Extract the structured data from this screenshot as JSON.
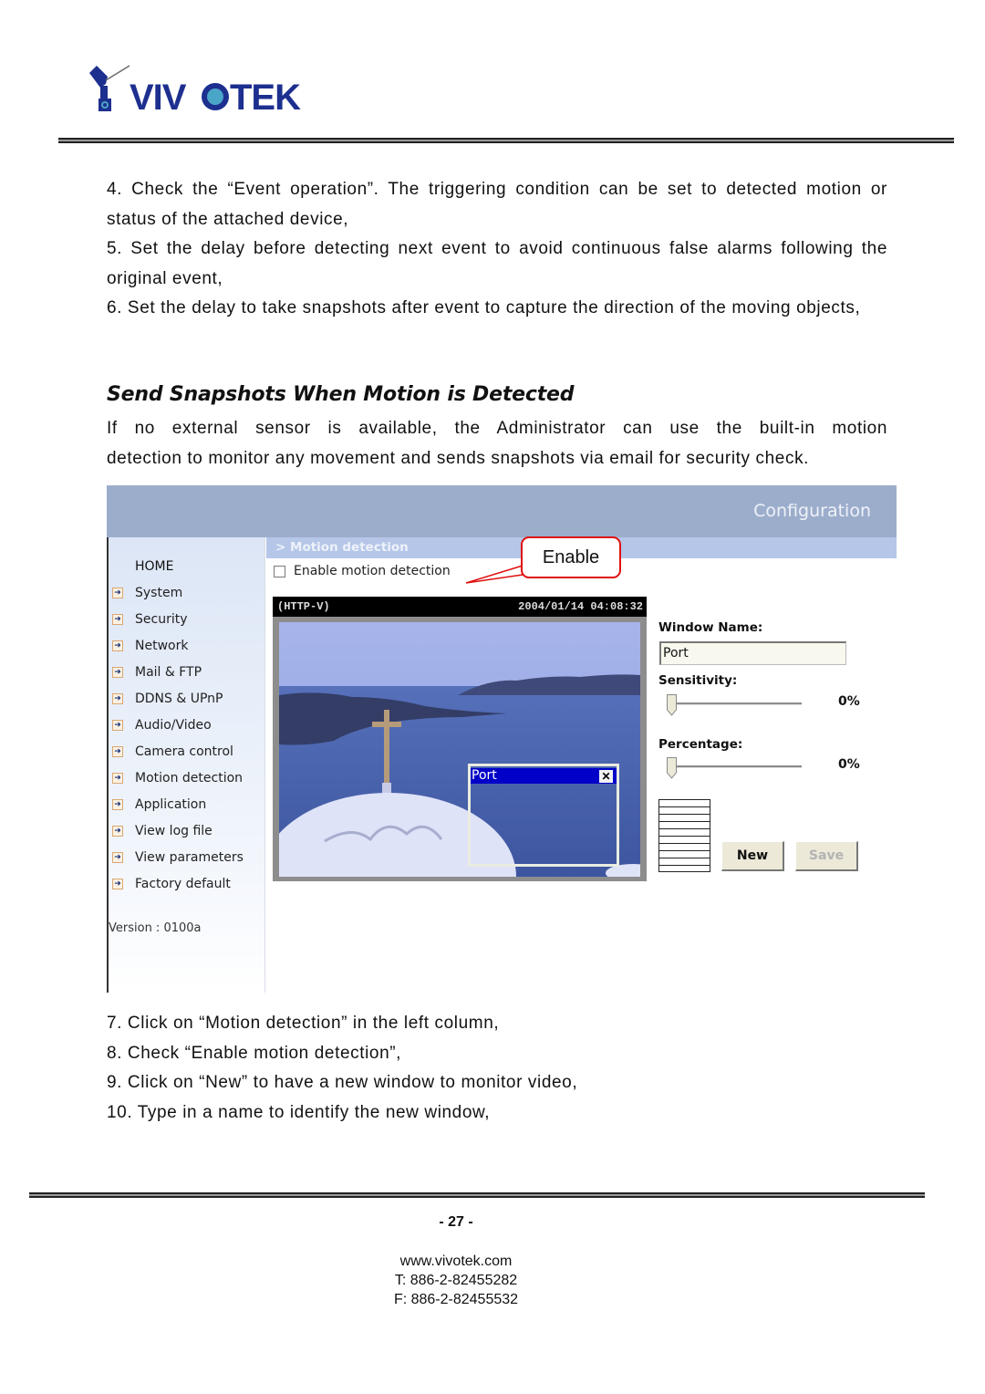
{
  "header": {
    "logo_text": "VIVOTEK",
    "brand_color": "#1d2f8f",
    "accent_color": "#4aa6c8"
  },
  "steps_top": [
    "4. Check the “Event operation”. The triggering condition can be set to detected motion or status of the attached device,",
    "5. Set the delay before detecting next event to avoid continuous false alarms following the original event,",
    "6. Set the delay to take snapshots after event to capture the direction of the moving objects,"
  ],
  "section": {
    "heading": "Send Snapshots When Motion is Detected",
    "intro_line1": "If no external sensor is available, the Administrator can use the built-in motion",
    "intro_line2": "detection to monitor any movement and sends snapshots via email for security check."
  },
  "screenshot": {
    "banner_title": "Configuration",
    "sidebar": {
      "home": "HOME",
      "items": [
        {
          "label": "System"
        },
        {
          "label": "Security"
        },
        {
          "label": "Network"
        },
        {
          "label": "Mail & FTP"
        },
        {
          "label": "DDNS & UPnP"
        },
        {
          "label": "Audio/Video"
        },
        {
          "label": "Camera control"
        },
        {
          "label": "Motion detection"
        },
        {
          "label": "Application"
        },
        {
          "label": "View log file"
        },
        {
          "label": "View parameters"
        },
        {
          "label": "Factory default"
        }
      ],
      "version": "Version : 0100a"
    },
    "breadcrumb": "> Motion detection",
    "enable_checkbox": {
      "label": "Enable motion detection",
      "checked": false
    },
    "callout": "Enable",
    "video": {
      "source": "(HTTP-V)",
      "timestamp": "2004/01/14 04:08:32",
      "motion_window_title": "Port"
    },
    "window_name": {
      "label": "Window Name:",
      "value": "Port"
    },
    "sensitivity": {
      "label": "Sensitivity:",
      "value_text": "0%",
      "value": 0
    },
    "percentage": {
      "label": "Percentage:",
      "value_text": "0%",
      "value": 0
    },
    "buttons": {
      "new": "New",
      "save": "Save"
    }
  },
  "steps_bottom": [
    "7. Click on “Motion detection” in the left column,",
    "8. Check “Enable motion detection”,",
    "9. Click on “New” to have a new window to monitor video,",
    "10. Type in a name to identify the new window,"
  ],
  "footer": {
    "page_number": "- 27 -",
    "website": "www.vivotek.com",
    "phone": "T: 886-2-82455282",
    "fax": "F: 886-2-82455532"
  }
}
